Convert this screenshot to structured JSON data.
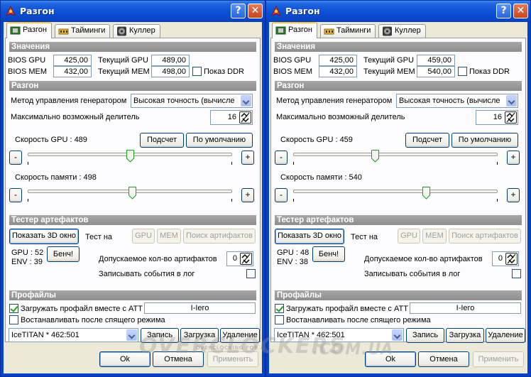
{
  "windows": [
    {
      "title": "Разгон",
      "tabs": [
        {
          "label": "Разгон"
        },
        {
          "label": "Тайминги"
        },
        {
          "label": "Куллер"
        }
      ],
      "values": {
        "section": "Значения",
        "bios_gpu_label": "BIOS GPU",
        "bios_gpu": "425,00",
        "bios_mem_label": "BIOS MEM",
        "bios_mem": "432,00",
        "cur_gpu_label": "Текущий GPU",
        "cur_gpu": "489,00",
        "cur_mem_label": "Текущий MEM",
        "cur_mem": "498,00",
        "show_ddr_label": "Показ DDR",
        "show_ddr_checked": false
      },
      "oc": {
        "section": "Разгон",
        "method_label": "Метод управления генератором",
        "method_value": "Высокая точность (вычисле",
        "divider_label": "Максимально возможный делитель",
        "divider_value": "16",
        "gpu_speed_label": "Скорость GPU : 489",
        "calc_button": "Подсчет",
        "default_button": "По умолчанию",
        "gpu_slider_pct": 0.5,
        "mem_speed_label": "Скорость памяти : 498",
        "mem_slider_pct": 0.51,
        "minus": "-",
        "plus": "+"
      },
      "artifacts": {
        "section": "Тестер артефактов",
        "show3d_button": "Показать 3D окно",
        "test_on_label": "Тест на",
        "gpu_button": "GPU",
        "mem_button": "MEM",
        "search_button": "Поиск артифактов",
        "gpu_value": "GPU : 52",
        "env_value": "ENV : 39",
        "bench_button": "Бенч!",
        "allowed_label": "Допускаемое кол-во артифактов",
        "allowed_value": "0",
        "log_label": "Записывать события в лог",
        "log_checked": false
      },
      "profiles": {
        "section": "Профайлы",
        "load_label": "Загружать профайл вместе с ATT",
        "load_checked": true,
        "profile_author": "I-Iero",
        "restore_label": "Востанавливать после спящего режима",
        "restore_checked": false,
        "profile_select": "IceTITAN * 462:501",
        "save_button": "Запись",
        "load_button": "Загрузка",
        "delete_button": "Удаление"
      },
      "footer": {
        "ok": "Ok",
        "cancel": "Отмена",
        "apply": "Применить"
      }
    },
    {
      "title": "Разгон",
      "tabs": [
        {
          "label": "Разгон"
        },
        {
          "label": "Тайминги"
        },
        {
          "label": "Куллер"
        }
      ],
      "values": {
        "section": "Значения",
        "bios_gpu_label": "BIOS GPU",
        "bios_gpu": "425,00",
        "bios_mem_label": "BIOS MEM",
        "bios_mem": "432,00",
        "cur_gpu_label": "Текущий GPU",
        "cur_gpu": "459,00",
        "cur_mem_label": "Текущий MEM",
        "cur_mem": "540,00",
        "show_ddr_label": "Показ DDR",
        "show_ddr_checked": false
      },
      "oc": {
        "section": "Разгон",
        "method_label": "Метод управления генератором",
        "method_value": "Высокая точность (вычисле",
        "divider_label": "Максимально возможный делитель",
        "divider_value": "16",
        "gpu_speed_label": "Скорость GPU : 459",
        "calc_button": "Подсчет",
        "default_button": "По умолчанию",
        "gpu_slider_pct": 0.4,
        "mem_speed_label": "Скорость памяти : 540",
        "mem_slider_pct": 0.65,
        "minus": "-",
        "plus": "+"
      },
      "artifacts": {
        "section": "Тестер артефактов",
        "show3d_button": "Показать 3D окно",
        "test_on_label": "Тест на",
        "gpu_button": "GPU",
        "mem_button": "MEM",
        "search_button": "Поиск артифактов",
        "gpu_value": "GPU : 48",
        "env_value": "ENV : 38",
        "bench_button": "Бенч!",
        "allowed_label": "Допускаемое кол-во артифактов",
        "allowed_value": "0",
        "log_label": "Записывать события в лог",
        "log_checked": false
      },
      "profiles": {
        "section": "Профайлы",
        "load_label": "Загружать профайл вместе с ATT",
        "load_checked": true,
        "profile_author": "I-Iero",
        "restore_label": "Востанавливать после спящего режима",
        "restore_checked": false,
        "profile_select": "IceTITAN * 462:501",
        "save_button": "Запись",
        "load_button": "Загрузка",
        "delete_button": "Удаление"
      },
      "footer": {
        "ok": "Ok",
        "cancel": "Отмена",
        "apply": "Применить"
      }
    }
  ],
  "watermark": {
    "brand": "OVERCLOCKERS",
    "tagline": "OVERCLOCKING FOR ALL",
    "domain": ".COM.UA"
  },
  "colors": {
    "titlebar": "#0a46c6",
    "section_header": "#9a9a9a",
    "face": "#ece9d8",
    "tab_highlight": "#ffc83c"
  }
}
